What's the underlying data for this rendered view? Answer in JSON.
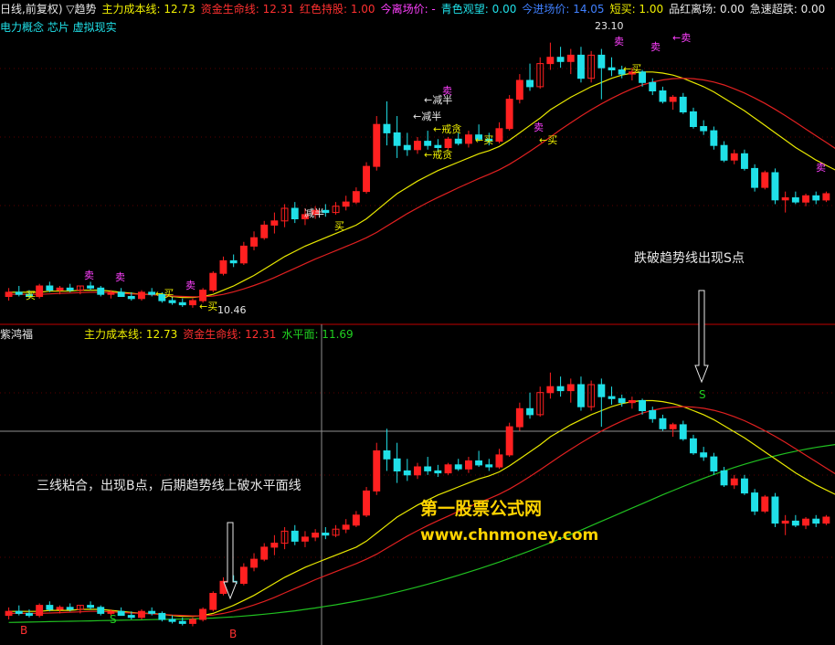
{
  "colors": {
    "background": "#000000",
    "up": "#ff2020",
    "down": "#20e0e8",
    "cost_line": "#e8e800",
    "life_line": "#e02020",
    "horizon_line": "#20c020",
    "text_white": "#e8e8e8",
    "text_yellow": "#f0f000",
    "text_red": "#ff3030",
    "text_green": "#20d020",
    "text_cyan": "#20e0e8",
    "text_blue": "#4080ff",
    "text_magenta": "#ff40ff"
  },
  "top_header": {
    "period": "日线,前复权) ▽趋势",
    "cost": "主力成本线: 12.73",
    "life": "资金生命线: 12.31",
    "red_hold": "红色持股: 1.00",
    "leave_label": "今离场价: -",
    "watch": "青色观望: 0.00",
    "enter": "今进场价: 14.05",
    "short_buy": "短买: 1.00",
    "pin_leave": "品红离场: 0.00",
    "quick_bounce": "急速超跌: 0.00"
  },
  "top_subheader": {
    "concept": "电力概念 芯片 虚拟现实"
  },
  "bottom_header": {
    "title": "紫鸿福",
    "cost": "主力成本线: 12.73",
    "life": "资金生命线: 12.31",
    "horizon": "水平面: 11.69"
  },
  "annotations": {
    "s_point": "跌破趋势线出现S点",
    "b_point": "三线粘合，出现B点，后期趋势线上破水平面线"
  },
  "watermark": {
    "line1": "第一股票公式网",
    "line2": "www.chnmoney.com"
  },
  "top_labels": {
    "high_price": "23.10",
    "low_price": "10.46",
    "buy": "买",
    "sell": "卖",
    "reduce_half": "减半",
    "caution": "戒贪",
    "arrow_buy": "←买",
    "arrow_reduce_half": "←减半",
    "arrow_caution": "←戒贪",
    "arrow_leave": "←卖"
  },
  "signals": {
    "b": "B",
    "s": "S"
  },
  "chart_data": {
    "type": "candlestick",
    "panels": [
      "price",
      "indicator"
    ],
    "price_range": [
      9.8,
      24.0
    ],
    "indicator_range": [
      9.8,
      24.0
    ],
    "candles": [
      {
        "o": 11.0,
        "h": 11.4,
        "l": 10.8,
        "c": 11.2
      },
      {
        "o": 11.2,
        "h": 11.5,
        "l": 11.0,
        "c": 11.1
      },
      {
        "o": 11.1,
        "h": 11.3,
        "l": 10.9,
        "c": 11.0
      },
      {
        "o": 11.0,
        "h": 11.6,
        "l": 10.9,
        "c": 11.5
      },
      {
        "o": 11.5,
        "h": 11.7,
        "l": 11.2,
        "c": 11.3
      },
      {
        "o": 11.3,
        "h": 11.5,
        "l": 11.1,
        "c": 11.4
      },
      {
        "o": 11.4,
        "h": 11.6,
        "l": 11.2,
        "c": 11.3
      },
      {
        "o": 11.3,
        "h": 11.5,
        "l": 11.1,
        "c": 11.5
      },
      {
        "o": 11.5,
        "h": 11.7,
        "l": 11.3,
        "c": 11.4
      },
      {
        "o": 11.4,
        "h": 11.5,
        "l": 11.0,
        "c": 11.1
      },
      {
        "o": 11.1,
        "h": 11.3,
        "l": 10.9,
        "c": 11.2
      },
      {
        "o": 11.2,
        "h": 11.4,
        "l": 11.0,
        "c": 11.0
      },
      {
        "o": 11.0,
        "h": 11.2,
        "l": 10.8,
        "c": 10.9
      },
      {
        "o": 10.9,
        "h": 11.3,
        "l": 10.8,
        "c": 11.2
      },
      {
        "o": 11.2,
        "h": 11.4,
        "l": 11.0,
        "c": 11.1
      },
      {
        "o": 11.1,
        "h": 11.2,
        "l": 10.7,
        "c": 10.8
      },
      {
        "o": 10.8,
        "h": 11.0,
        "l": 10.6,
        "c": 10.7
      },
      {
        "o": 10.7,
        "h": 10.9,
        "l": 10.5,
        "c": 10.6
      },
      {
        "o": 10.6,
        "h": 10.9,
        "l": 10.46,
        "c": 10.8
      },
      {
        "o": 10.8,
        "h": 11.4,
        "l": 10.7,
        "c": 11.3
      },
      {
        "o": 11.3,
        "h": 12.2,
        "l": 11.2,
        "c": 12.1
      },
      {
        "o": 12.1,
        "h": 12.9,
        "l": 12.0,
        "c": 12.7
      },
      {
        "o": 12.7,
        "h": 13.0,
        "l": 12.4,
        "c": 12.6
      },
      {
        "o": 12.6,
        "h": 13.6,
        "l": 12.5,
        "c": 13.4
      },
      {
        "o": 13.4,
        "h": 14.1,
        "l": 13.2,
        "c": 13.8
      },
      {
        "o": 13.8,
        "h": 14.6,
        "l": 13.7,
        "c": 14.4
      },
      {
        "o": 14.4,
        "h": 15.0,
        "l": 14.0,
        "c": 14.6
      },
      {
        "o": 14.6,
        "h": 15.4,
        "l": 14.3,
        "c": 15.2
      },
      {
        "o": 15.2,
        "h": 15.5,
        "l": 14.5,
        "c": 14.7
      },
      {
        "o": 14.7,
        "h": 15.2,
        "l": 14.4,
        "c": 14.9
      },
      {
        "o": 14.9,
        "h": 15.3,
        "l": 14.7,
        "c": 15.1
      },
      {
        "o": 15.1,
        "h": 15.4,
        "l": 14.8,
        "c": 15.0
      },
      {
        "o": 15.0,
        "h": 15.5,
        "l": 14.9,
        "c": 15.3
      },
      {
        "o": 15.3,
        "h": 15.8,
        "l": 15.1,
        "c": 15.5
      },
      {
        "o": 15.5,
        "h": 16.2,
        "l": 15.4,
        "c": 16.0
      },
      {
        "o": 16.0,
        "h": 17.4,
        "l": 15.9,
        "c": 17.2
      },
      {
        "o": 17.2,
        "h": 19.6,
        "l": 17.0,
        "c": 19.2
      },
      {
        "o": 19.2,
        "h": 20.3,
        "l": 18.2,
        "c": 18.8
      },
      {
        "o": 18.8,
        "h": 19.6,
        "l": 17.6,
        "c": 18.2
      },
      {
        "o": 18.2,
        "h": 18.8,
        "l": 17.7,
        "c": 18.0
      },
      {
        "o": 18.0,
        "h": 18.6,
        "l": 17.8,
        "c": 18.4
      },
      {
        "o": 18.4,
        "h": 18.9,
        "l": 18.0,
        "c": 18.2
      },
      {
        "o": 18.2,
        "h": 18.5,
        "l": 17.9,
        "c": 18.1
      },
      {
        "o": 18.1,
        "h": 18.6,
        "l": 18.0,
        "c": 18.5
      },
      {
        "o": 18.5,
        "h": 18.8,
        "l": 18.2,
        "c": 18.3
      },
      {
        "o": 18.3,
        "h": 18.9,
        "l": 18.1,
        "c": 18.7
      },
      {
        "o": 18.7,
        "h": 19.2,
        "l": 18.4,
        "c": 18.5
      },
      {
        "o": 18.5,
        "h": 18.8,
        "l": 18.2,
        "c": 18.4
      },
      {
        "o": 18.4,
        "h": 19.3,
        "l": 18.3,
        "c": 19.0
      },
      {
        "o": 19.0,
        "h": 20.6,
        "l": 18.9,
        "c": 20.4
      },
      {
        "o": 20.4,
        "h": 21.6,
        "l": 20.2,
        "c": 21.3
      },
      {
        "o": 21.3,
        "h": 22.1,
        "l": 20.8,
        "c": 21.0
      },
      {
        "o": 21.0,
        "h": 22.4,
        "l": 20.9,
        "c": 22.1
      },
      {
        "o": 22.1,
        "h": 23.1,
        "l": 21.8,
        "c": 22.4
      },
      {
        "o": 22.4,
        "h": 22.9,
        "l": 21.9,
        "c": 22.2
      },
      {
        "o": 22.2,
        "h": 22.8,
        "l": 21.6,
        "c": 22.5
      },
      {
        "o": 22.5,
        "h": 22.9,
        "l": 21.2,
        "c": 21.4
      },
      {
        "o": 21.4,
        "h": 22.7,
        "l": 21.2,
        "c": 22.5
      },
      {
        "o": 22.5,
        "h": 22.8,
        "l": 20.4,
        "c": 21.9
      },
      {
        "o": 21.9,
        "h": 22.4,
        "l": 21.5,
        "c": 21.8
      },
      {
        "o": 21.8,
        "h": 22.0,
        "l": 21.4,
        "c": 21.6
      },
      {
        "o": 21.6,
        "h": 21.9,
        "l": 21.3,
        "c": 21.7
      },
      {
        "o": 21.7,
        "h": 21.8,
        "l": 21.0,
        "c": 21.2
      },
      {
        "o": 21.2,
        "h": 21.4,
        "l": 20.6,
        "c": 20.8
      },
      {
        "o": 20.8,
        "h": 21.0,
        "l": 20.2,
        "c": 20.3
      },
      {
        "o": 20.3,
        "h": 20.6,
        "l": 19.9,
        "c": 20.5
      },
      {
        "o": 20.5,
        "h": 20.7,
        "l": 19.7,
        "c": 19.8
      },
      {
        "o": 19.8,
        "h": 20.0,
        "l": 19.0,
        "c": 19.1
      },
      {
        "o": 19.1,
        "h": 19.4,
        "l": 18.7,
        "c": 18.9
      },
      {
        "o": 18.9,
        "h": 19.1,
        "l": 18.0,
        "c": 18.2
      },
      {
        "o": 18.2,
        "h": 18.4,
        "l": 17.4,
        "c": 17.5
      },
      {
        "o": 17.5,
        "h": 18.0,
        "l": 17.3,
        "c": 17.8
      },
      {
        "o": 17.8,
        "h": 18.0,
        "l": 17.0,
        "c": 17.1
      },
      {
        "o": 17.1,
        "h": 17.3,
        "l": 16.0,
        "c": 16.2
      },
      {
        "o": 16.2,
        "h": 17.0,
        "l": 16.1,
        "c": 16.9
      },
      {
        "o": 16.9,
        "h": 17.1,
        "l": 15.4,
        "c": 15.6
      },
      {
        "o": 15.6,
        "h": 16.0,
        "l": 15.0,
        "c": 15.7
      },
      {
        "o": 15.7,
        "h": 16.0,
        "l": 15.4,
        "c": 15.5
      },
      {
        "o": 15.5,
        "h": 15.9,
        "l": 15.3,
        "c": 15.8
      },
      {
        "o": 15.8,
        "h": 16.0,
        "l": 15.4,
        "c": 15.6
      },
      {
        "o": 15.6,
        "h": 16.0,
        "l": 15.5,
        "c": 15.9
      }
    ],
    "cost_line": [
      11.2,
      11.2,
      11.2,
      11.2,
      11.25,
      11.25,
      11.25,
      11.3,
      11.3,
      11.3,
      11.25,
      11.2,
      11.15,
      11.1,
      11.1,
      11.05,
      11.0,
      10.95,
      10.95,
      11.0,
      11.1,
      11.3,
      11.5,
      11.75,
      12.0,
      12.3,
      12.6,
      12.9,
      13.15,
      13.4,
      13.6,
      13.8,
      14.0,
      14.2,
      14.4,
      14.7,
      15.1,
      15.5,
      15.9,
      16.2,
      16.5,
      16.75,
      17.0,
      17.2,
      17.4,
      17.6,
      17.8,
      17.95,
      18.15,
      18.45,
      18.8,
      19.15,
      19.5,
      19.9,
      20.2,
      20.5,
      20.75,
      21.0,
      21.2,
      21.4,
      21.55,
      21.65,
      21.7,
      21.7,
      21.65,
      21.55,
      21.4,
      21.2,
      21.0,
      20.75,
      20.45,
      20.15,
      19.85,
      19.5,
      19.15,
      18.8,
      18.45,
      18.1,
      17.8,
      17.5,
      17.25,
      17.0
    ],
    "life_line": [
      11.1,
      11.1,
      11.1,
      11.1,
      11.12,
      11.14,
      11.16,
      11.18,
      11.2,
      11.2,
      11.18,
      11.15,
      11.12,
      11.1,
      11.08,
      11.05,
      11.02,
      11.0,
      10.98,
      10.98,
      11.02,
      11.1,
      11.22,
      11.36,
      11.52,
      11.7,
      11.9,
      12.12,
      12.34,
      12.56,
      12.78,
      12.98,
      13.18,
      13.38,
      13.58,
      13.8,
      14.05,
      14.35,
      14.65,
      14.95,
      15.22,
      15.48,
      15.72,
      15.95,
      16.18,
      16.4,
      16.62,
      16.82,
      17.04,
      17.3,
      17.6,
      17.92,
      18.25,
      18.6,
      18.95,
      19.28,
      19.6,
      19.9,
      20.18,
      20.44,
      20.68,
      20.9,
      21.08,
      21.22,
      21.32,
      21.38,
      21.4,
      21.38,
      21.32,
      21.22,
      21.08,
      20.9,
      20.7,
      20.46,
      20.2,
      19.92,
      19.62,
      19.3,
      18.98,
      18.66,
      18.34,
      18.02
    ],
    "horizon_line": [
      10.65,
      10.66,
      10.67,
      10.68,
      10.69,
      10.7,
      10.71,
      10.72,
      10.73,
      10.74,
      10.75,
      10.76,
      10.77,
      10.78,
      10.79,
      10.8,
      10.81,
      10.82,
      10.83,
      10.85,
      10.87,
      10.9,
      10.93,
      10.97,
      11.01,
      11.06,
      11.11,
      11.17,
      11.23,
      11.3,
      11.37,
      11.45,
      11.53,
      11.62,
      11.71,
      11.81,
      11.92,
      12.04,
      12.16,
      12.29,
      12.42,
      12.56,
      12.7,
      12.85,
      13.0,
      13.16,
      13.32,
      13.49,
      13.66,
      13.84,
      14.03,
      14.22,
      14.42,
      14.62,
      14.83,
      15.04,
      15.25,
      15.47,
      15.69,
      15.91,
      16.13,
      16.35,
      16.57,
      16.79,
      17.01,
      17.22,
      17.43,
      17.63,
      17.83,
      18.02,
      18.2,
      18.37,
      18.53,
      18.68,
      18.82,
      18.95,
      19.07,
      19.18,
      19.28,
      19.37,
      19.45,
      19.52
    ]
  }
}
